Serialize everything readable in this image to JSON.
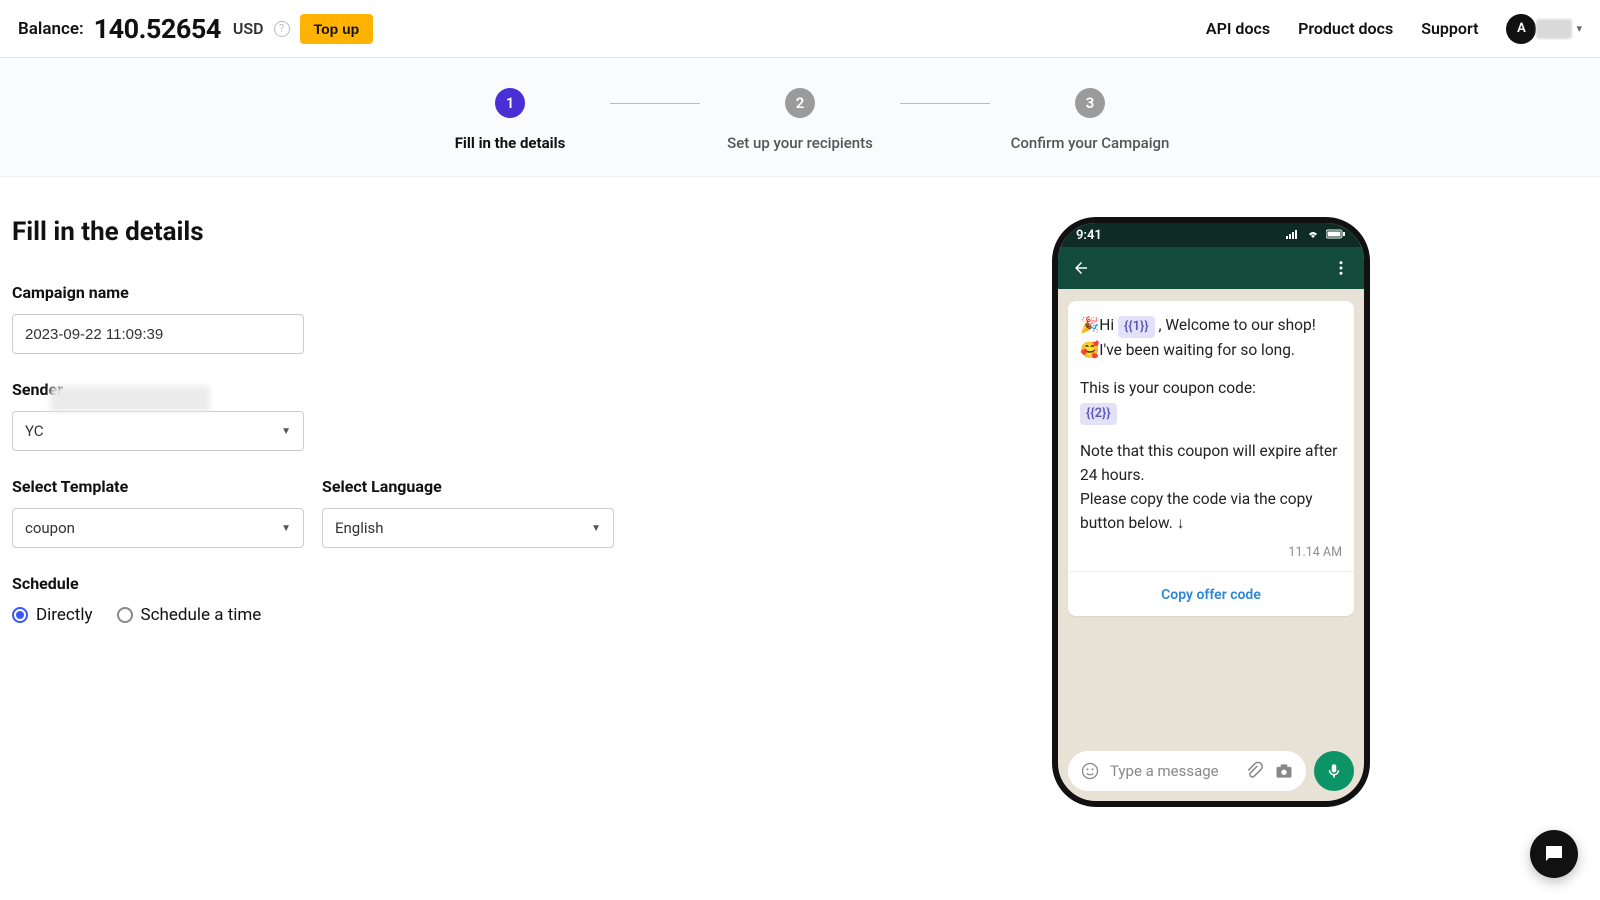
{
  "header": {
    "balance_label": "Balance:",
    "balance_amount": "140.52654",
    "balance_currency": "USD",
    "topup_label": "Top up",
    "nav": {
      "api_docs": "API docs",
      "product_docs": "Product docs",
      "support": "Support"
    },
    "avatar_letter": "A"
  },
  "stepper": {
    "steps": [
      {
        "num": "1",
        "label": "Fill in the details"
      },
      {
        "num": "2",
        "label": "Set up your recipients"
      },
      {
        "num": "3",
        "label": "Confirm your Campaign"
      }
    ]
  },
  "form": {
    "section_title": "Fill in the details",
    "campaign_name_label": "Campaign name",
    "campaign_name_value": "2023-09-22 11:09:39",
    "sender_label": "Sender",
    "sender_value_prefix": "YC",
    "template_label": "Select Template",
    "template_value": "coupon",
    "language_label": "Select Language",
    "language_value": "English",
    "schedule_label": "Schedule",
    "schedule_options": {
      "directly": "Directly",
      "scheduled": "Schedule a time"
    }
  },
  "preview": {
    "status_time": "9:41",
    "msg_line1_prefix": "🎉Hi ",
    "msg_placeholder1": "{{1}}",
    "msg_line1_suffix": " , Welcome to our shop!",
    "msg_line2": "🥰I've been waiting for so long.",
    "msg_line3": "This is your coupon code:",
    "msg_placeholder2": "{{2}}",
    "msg_line4": "Note that this coupon will expire after 24 hours.",
    "msg_line5": "Please copy the code via the copy button below. ↓",
    "msg_time": "11.14 AM",
    "copy_button": "Copy offer code",
    "input_placeholder": "Type a message"
  }
}
